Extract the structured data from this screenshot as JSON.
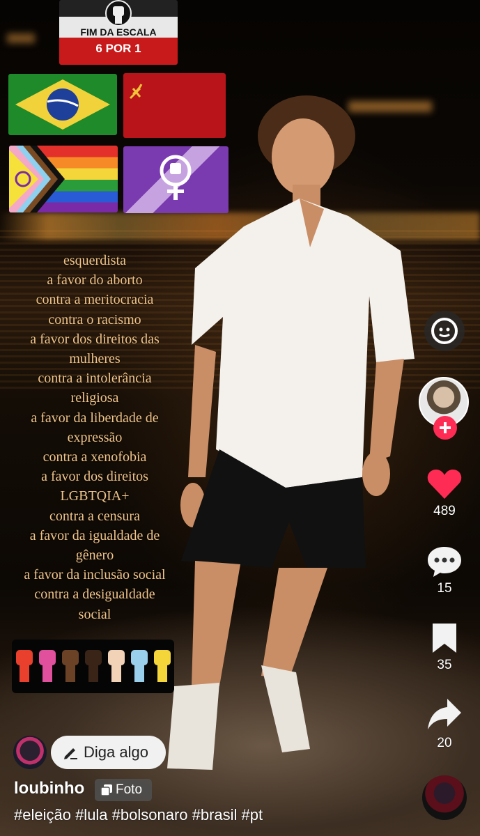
{
  "flags": {
    "scale_line1": "FIM DA ESCALA",
    "scale_line2": "6 POR 1"
  },
  "stances": [
    "esquerdista",
    "a favor do aborto",
    "contra a meritocracia",
    "contra o racismo",
    "a favor dos direitos das",
    "mulheres",
    "contra a intolerância",
    "religiosa",
    "a favor da liberdade de",
    "expressão",
    "contra a xenofobia",
    "a favor dos direitos",
    "LGBTQIA+",
    "contra a censura",
    "a favor da igualdade de",
    "gênero",
    "a favor da inclusão social",
    "contra a desigualdade",
    "social"
  ],
  "fist_colors": [
    "#e8402c",
    "#e0509c",
    "#6b4226",
    "#3a2418",
    "#f3d3b8",
    "#9ad0ec",
    "#f4d63a"
  ],
  "rail": {
    "like_count": "489",
    "comment_count": "15",
    "save_count": "35",
    "share_count": "20",
    "like_color": "#fe2c55",
    "follow_color": "#fe2c55"
  },
  "bottom": {
    "comment_placeholder": "Diga algo",
    "username": "loubinho",
    "badge_label": "Foto",
    "hashtags": "#eleição #lula #bolsonaro #brasil #pt"
  }
}
